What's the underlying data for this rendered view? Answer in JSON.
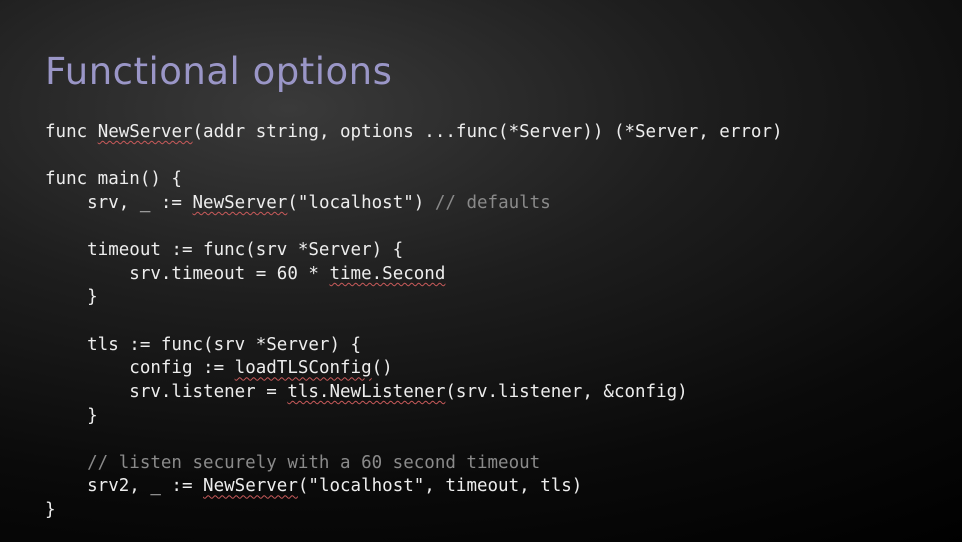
{
  "title": "Functional options",
  "code": {
    "l1a": "func ",
    "l1b": "NewServer",
    "l1c": "(addr string, options ...func(*Server)) (*Server, error)",
    "l2": "",
    "l3": "func main() {",
    "l4a": "    srv, _ := ",
    "l4b": "NewServer",
    "l4c": "(\"localhost\") ",
    "l4d": "// defaults",
    "l5": "",
    "l6": "    timeout := func(srv *Server) {",
    "l7a": "        srv.timeout = 60 * ",
    "l7b": "time.Second",
    "l8": "    }",
    "l9": "",
    "l10": "    tls := func(srv *Server) {",
    "l11a": "        config := ",
    "l11b": "loadTLSConfig",
    "l11c": "()",
    "l12a": "        srv.listener = ",
    "l12b": "tls.NewListener",
    "l12c": "(srv.listener, &config)",
    "l13": "    }",
    "l14": "",
    "l15": "    // listen securely with a 60 second timeout",
    "l16a": "    srv2, _ := ",
    "l16b": "NewServer",
    "l16c": "(\"localhost\", timeout, tls)",
    "l17": "}"
  }
}
